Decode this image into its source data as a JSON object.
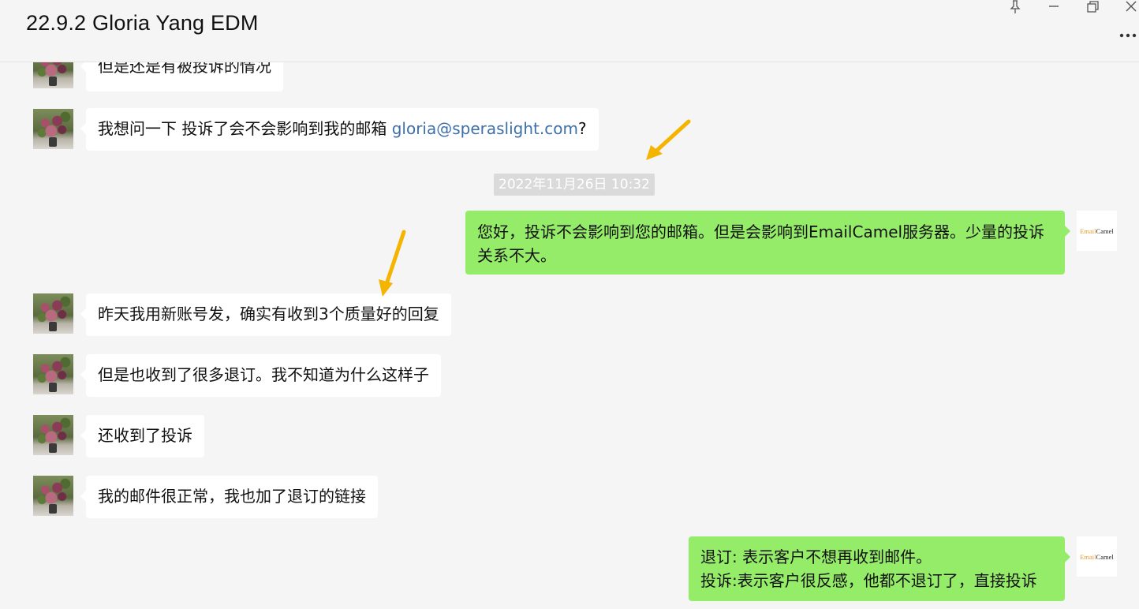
{
  "window": {
    "title": "22.9.2 Gloria Yang EDM",
    "controls": [
      "pin-icon",
      "minimize-icon",
      "restore-icon",
      "close-icon"
    ],
    "more_icon": "more-dots-icon"
  },
  "colors": {
    "background": "#f5f5f5",
    "bubble_incoming": "#ffffff",
    "bubble_outgoing": "#95ec69",
    "link": "#3d6fa8",
    "annotation_arrow": "#f5b400"
  },
  "messages": [
    {
      "side": "left",
      "text": "但是还是有被投诉的情况"
    },
    {
      "side": "left",
      "text_before": "我想问一下 投诉了会不会影响到我的邮箱 ",
      "link": "gloria@speraslight.com",
      "text_after": "?"
    },
    {
      "timestamp": "2022年11月26日 10:32"
    },
    {
      "side": "right",
      "text": "您好，投诉不会影响到您的邮箱。但是会影响到EmailCamel服务器。少量的投诉关系不大。"
    },
    {
      "side": "left",
      "text": "昨天我用新账号发，确实有收到3个质量好的回复"
    },
    {
      "side": "left",
      "text": "但是也收到了很多退订。我不知道为什么这样子"
    },
    {
      "side": "left",
      "text": "还收到了投诉"
    },
    {
      "side": "left",
      "text": "我的邮件很正常，我也加了退订的链接"
    },
    {
      "side": "right",
      "lines": [
        "退订: 表示客户不想再收到邮件。",
        "投诉:表示客户很反感，他都不退订了，直接投诉"
      ]
    }
  ],
  "avatars": {
    "contact": {
      "icon": "flower-photo-avatar"
    },
    "self": {
      "logo_part1": "Email",
      "logo_part2": "Camel"
    }
  }
}
